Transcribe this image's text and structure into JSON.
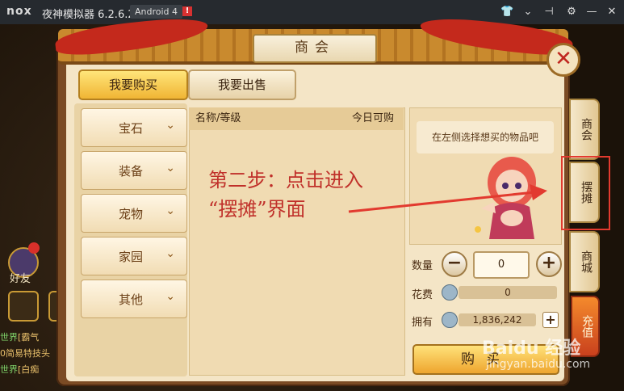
{
  "titlebar": {
    "logo": "nox",
    "app_title": "夜神模拟器 6.2.6.2",
    "android_badge": "Android 4",
    "alert": "!",
    "icons": [
      "shirt-icon",
      "chevron-down-icon",
      "pin-icon",
      "gear-icon",
      "minimize-icon",
      "close-icon"
    ]
  },
  "hud": {
    "friends_label": "好友",
    "chat_lines": [
      {
        "tag": "世界",
        "text": "[霸气"
      },
      {
        "tag": "",
        "text": "0简易特技头"
      },
      {
        "tag": "世界",
        "text": "[白痴"
      }
    ]
  },
  "panel": {
    "title": "商会",
    "tabs": {
      "buy": "我要购买",
      "sell": "我要出售"
    },
    "categories": [
      "宝石",
      "装备",
      "宠物",
      "家园",
      "其他"
    ],
    "list_headers": {
      "name": "名称/等级",
      "avail": "今日可购"
    },
    "hint": "在左侧选择想买的物品吧",
    "qty_label": "数量",
    "qty_value": "0",
    "cost_label": "花费",
    "cost_value": "0",
    "own_label": "拥有",
    "own_value": "1,836,242",
    "buy_button": "购买",
    "side_tabs": [
      "商会",
      "摆摊",
      "商城"
    ],
    "recharge_tab": "充值"
  },
  "annotation": {
    "line1": "第二步：点击进入",
    "line2": "“摆摊”界面",
    "color": "#c0302a"
  },
  "watermark": {
    "brand": "Baidu 经验",
    "url": "jingyan.baidu.com"
  }
}
